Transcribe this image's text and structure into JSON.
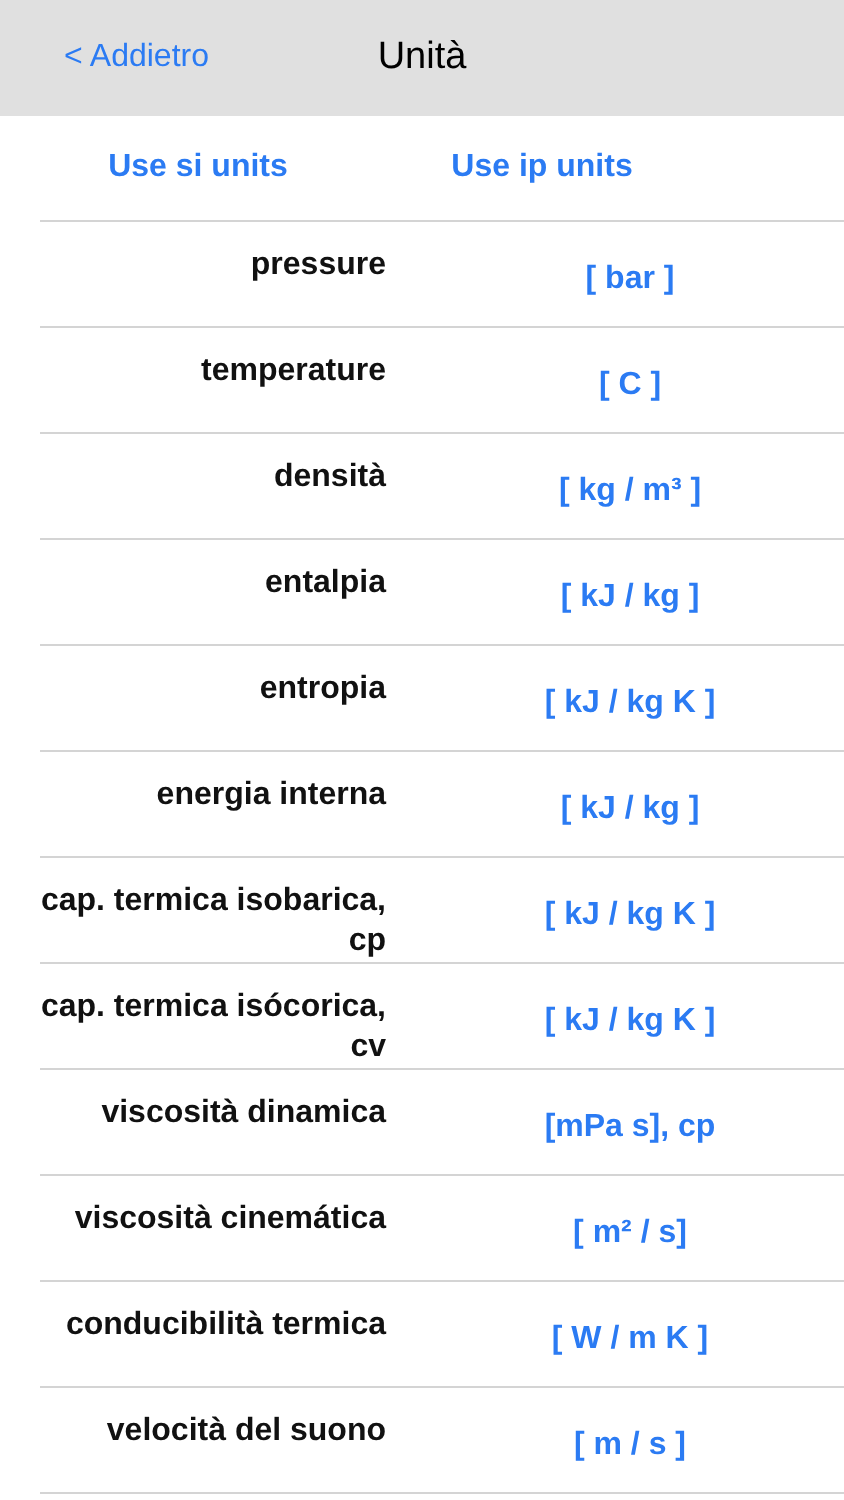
{
  "nav_bar": {
    "back": "< Addietro",
    "title": "Unità"
  },
  "unit_systems": [
    {
      "label": "Use si units"
    },
    {
      "label": "Use ip units"
    }
  ],
  "rows": [
    {
      "quantity": "pressure",
      "unit": "[ bar ]"
    },
    {
      "quantity": "temperature",
      "unit": "[ C ]"
    },
    {
      "quantity": "densità",
      "unit": "[ kg / m³ ]"
    },
    {
      "quantity": "entalpia",
      "unit": "[ kJ / kg ]"
    },
    {
      "quantity": "entropia",
      "unit": "[ kJ / kg K ]"
    },
    {
      "quantity": "energia interna",
      "unit": "[ kJ / kg ]"
    },
    {
      "quantity": "cap. termica isobarica, cp",
      "unit": "[ kJ / kg K ]"
    },
    {
      "quantity": "cap. termica isócorica, cv",
      "unit": "[ kJ / kg K ]"
    },
    {
      "quantity": "viscosità dinamica",
      "unit": "[mPa s], cp"
    },
    {
      "quantity": "viscosità cinemática",
      "unit": "[ m² / s]"
    },
    {
      "quantity": "conducibilità termica",
      "unit": "[ W / m K ]"
    },
    {
      "quantity": "velocità del suono",
      "unit": "[ m / s ]"
    }
  ]
}
